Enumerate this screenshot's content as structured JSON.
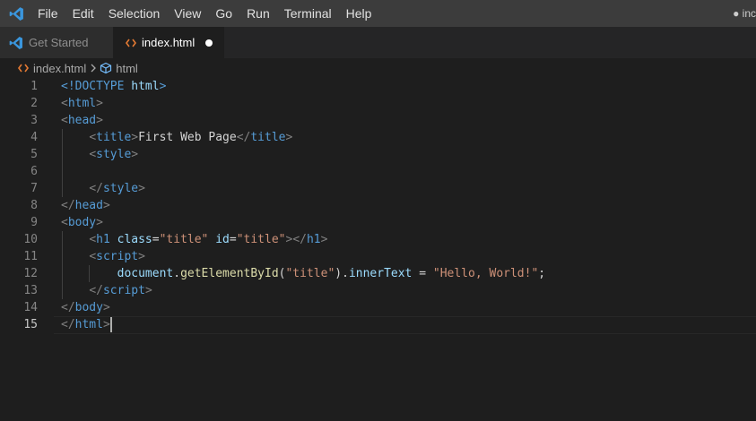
{
  "menu": [
    "File",
    "Edit",
    "Selection",
    "View",
    "Go",
    "Run",
    "Terminal",
    "Help"
  ],
  "window_title": "● inc",
  "tabs": [
    {
      "label": "Get Started",
      "active": false
    },
    {
      "label": "index.html",
      "active": true,
      "dirty": true
    }
  ],
  "breadcrumb": {
    "file": "index.html",
    "symbol": "html"
  },
  "editor": {
    "current_line": 15,
    "line_numbers": [
      "1",
      "2",
      "3",
      "4",
      "5",
      "6",
      "7",
      "8",
      "9",
      "10",
      "11",
      "12",
      "13",
      "14",
      "15"
    ],
    "lines": [
      [
        {
          "t": "<!DOCTYPE ",
          "c": "tag"
        },
        {
          "t": "html",
          "c": "attr"
        },
        {
          "t": ">",
          "c": "tag"
        }
      ],
      [
        {
          "t": "<",
          "c": "punct"
        },
        {
          "t": "html",
          "c": "tag"
        },
        {
          "t": ">",
          "c": "punct"
        }
      ],
      [
        {
          "t": "<",
          "c": "punct"
        },
        {
          "t": "head",
          "c": "tag"
        },
        {
          "t": ">",
          "c": "punct"
        }
      ],
      [
        {
          "t": "    ",
          "c": "text"
        },
        {
          "t": "<",
          "c": "punct"
        },
        {
          "t": "title",
          "c": "tag"
        },
        {
          "t": ">",
          "c": "punct"
        },
        {
          "t": "First Web Page",
          "c": "text"
        },
        {
          "t": "</",
          "c": "punct"
        },
        {
          "t": "title",
          "c": "tag"
        },
        {
          "t": ">",
          "c": "punct"
        }
      ],
      [
        {
          "t": "    ",
          "c": "text"
        },
        {
          "t": "<",
          "c": "punct"
        },
        {
          "t": "style",
          "c": "tag"
        },
        {
          "t": ">",
          "c": "punct"
        }
      ],
      [],
      [
        {
          "t": "    ",
          "c": "text"
        },
        {
          "t": "</",
          "c": "punct"
        },
        {
          "t": "style",
          "c": "tag"
        },
        {
          "t": ">",
          "c": "punct"
        }
      ],
      [
        {
          "t": "</",
          "c": "punct"
        },
        {
          "t": "head",
          "c": "tag"
        },
        {
          "t": ">",
          "c": "punct"
        }
      ],
      [
        {
          "t": "<",
          "c": "punct"
        },
        {
          "t": "body",
          "c": "tag"
        },
        {
          "t": ">",
          "c": "punct"
        }
      ],
      [
        {
          "t": "    ",
          "c": "text"
        },
        {
          "t": "<",
          "c": "punct"
        },
        {
          "t": "h1",
          "c": "tag"
        },
        {
          "t": " ",
          "c": "text"
        },
        {
          "t": "class",
          "c": "attr"
        },
        {
          "t": "=",
          "c": "text"
        },
        {
          "t": "\"title\"",
          "c": "str"
        },
        {
          "t": " ",
          "c": "text"
        },
        {
          "t": "id",
          "c": "attr"
        },
        {
          "t": "=",
          "c": "text"
        },
        {
          "t": "\"title\"",
          "c": "str"
        },
        {
          "t": "></",
          "c": "punct"
        },
        {
          "t": "h1",
          "c": "tag"
        },
        {
          "t": ">",
          "c": "punct"
        }
      ],
      [
        {
          "t": "    ",
          "c": "text"
        },
        {
          "t": "<",
          "c": "punct"
        },
        {
          "t": "script",
          "c": "tag"
        },
        {
          "t": ">",
          "c": "punct"
        }
      ],
      [
        {
          "t": "        ",
          "c": "text"
        },
        {
          "t": "document",
          "c": "attr"
        },
        {
          "t": ".",
          "c": "text"
        },
        {
          "t": "getElementById",
          "c": "fn"
        },
        {
          "t": "(",
          "c": "text"
        },
        {
          "t": "\"title\"",
          "c": "str"
        },
        {
          "t": ").",
          "c": "text"
        },
        {
          "t": "innerText",
          "c": "attr"
        },
        {
          "t": " = ",
          "c": "text"
        },
        {
          "t": "\"Hello, World!\"",
          "c": "str"
        },
        {
          "t": ";",
          "c": "text"
        }
      ],
      [
        {
          "t": "    ",
          "c": "text"
        },
        {
          "t": "</",
          "c": "punct"
        },
        {
          "t": "script",
          "c": "tag"
        },
        {
          "t": ">",
          "c": "punct"
        }
      ],
      [
        {
          "t": "</",
          "c": "punct"
        },
        {
          "t": "body",
          "c": "tag"
        },
        {
          "t": ">",
          "c": "punct"
        }
      ],
      [
        {
          "t": "</",
          "c": "punct"
        },
        {
          "t": "html",
          "c": "tag"
        },
        {
          "t": ">",
          "c": "punct"
        }
      ]
    ]
  },
  "colors": {
    "titlebar": "#3c3c3c",
    "editor_bg": "#1e1e1e",
    "accent_icon": "#3a96dd",
    "html_file_icon": "#e37933"
  },
  "icons": {
    "app": "vscode-logo-icon",
    "get_started": "vscode-logo-icon",
    "html_file": "html-file-icon",
    "symbol": "symbol-cube-icon",
    "separator": "chevron-right-icon"
  }
}
